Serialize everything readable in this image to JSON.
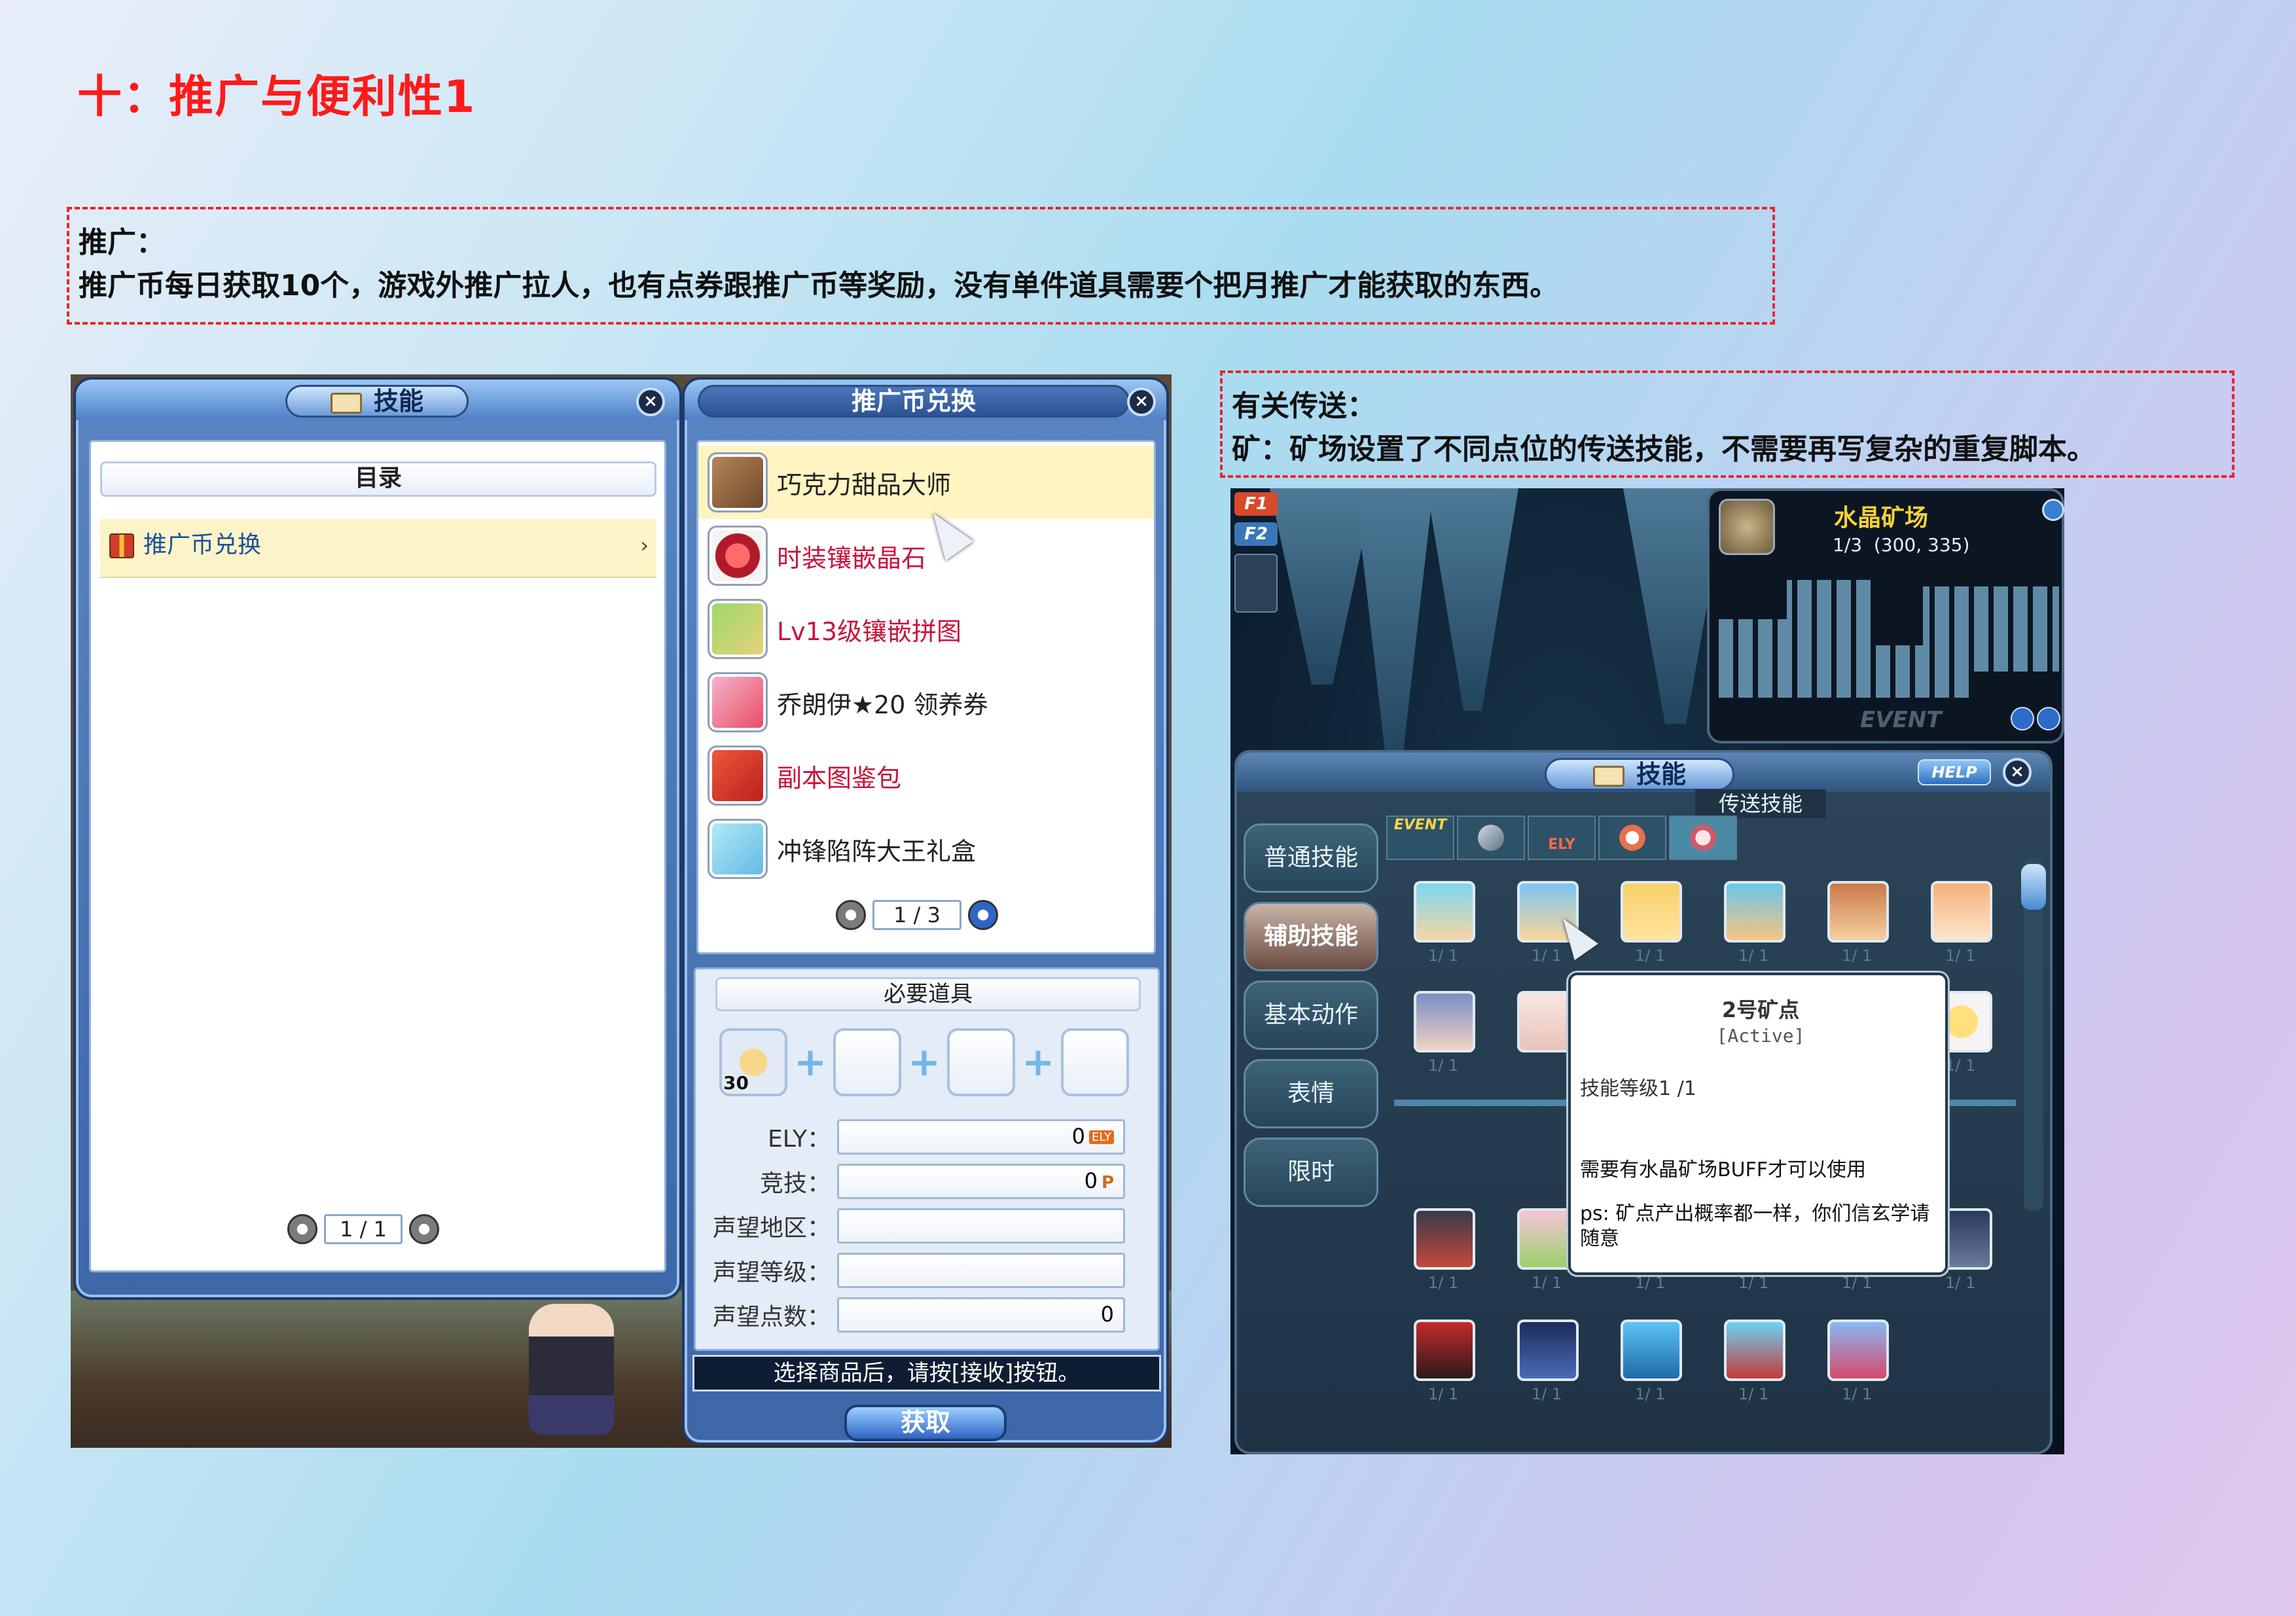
{
  "page": {
    "title": "十：推广与便利性1"
  },
  "note_promo": {
    "heading": "推广：",
    "text": "推广币每日获取10个，游戏外推广拉人，也有点券跟推广币等奖励，没有单件道具需要个把月推广才能获取的东西。"
  },
  "note_teleport": {
    "heading": "有关传送：",
    "text": "矿：矿场设置了不同点位的传送技能，不需要再写复杂的重复脚本。"
  },
  "skill_window": {
    "title": "技能",
    "category_header": "目录",
    "category_item": "推广币兑换",
    "pager": "1 / 1"
  },
  "exchange_window": {
    "title": "推广币兑换",
    "items": [
      {
        "name": "巧克力甜品大师",
        "color": "#222222"
      },
      {
        "name": "时装镶嵌晶石",
        "color": "#c8143c"
      },
      {
        "name": "Lv13级镶嵌拼图",
        "color": "#c8143c"
      },
      {
        "name": "乔朗伊★20 领养券",
        "color": "#222222"
      },
      {
        "name": "副本图鉴包",
        "color": "#c8143c"
      },
      {
        "name": "冲锋陷阵大王礼盒",
        "color": "#222222"
      }
    ],
    "pager": "1 / 3",
    "required_header": "必要道具",
    "slot_badge": "30",
    "fields": [
      {
        "label": "ELY：",
        "value": "0",
        "unit": "ELY"
      },
      {
        "label": "竞技：",
        "value": "0",
        "unit": "P"
      },
      {
        "label": "声望地区：",
        "value": ""
      },
      {
        "label": "声望等级：",
        "value": ""
      },
      {
        "label": "声望点数：",
        "value": "0"
      }
    ],
    "hint": "选择商品后，请按[接收]按钮。",
    "get_button": "获取"
  },
  "game": {
    "channel_buttons": [
      "F1",
      "F2"
    ],
    "minimap": {
      "title": "水晶矿场",
      "coords": "1/3  (300, 335)",
      "event": "EVENT"
    },
    "skill_window": {
      "title": "技能",
      "help": "HELP",
      "active_tab_label": "传送技能",
      "side_tabs": [
        "普通技能",
        "辅助技能",
        "基本动作",
        "表情",
        "限时"
      ],
      "top_tabs": [
        "EVENT",
        "ELY"
      ],
      "level_label": "1/ 1"
    },
    "tooltip": {
      "title": "2号矿点",
      "subtitle": "[Active]",
      "level": "技能等级1 /1",
      "desc": "需要有水晶矿场BUFF才可以使用",
      "ps": "ps: 矿点产出概率都一样，你们信玄学请随意"
    }
  },
  "colors": {
    "title_red": "#ff1a1a",
    "dashed_border": "#e8262b",
    "window_blue": "#3d67a8",
    "selected_row": "#fff4c2"
  }
}
